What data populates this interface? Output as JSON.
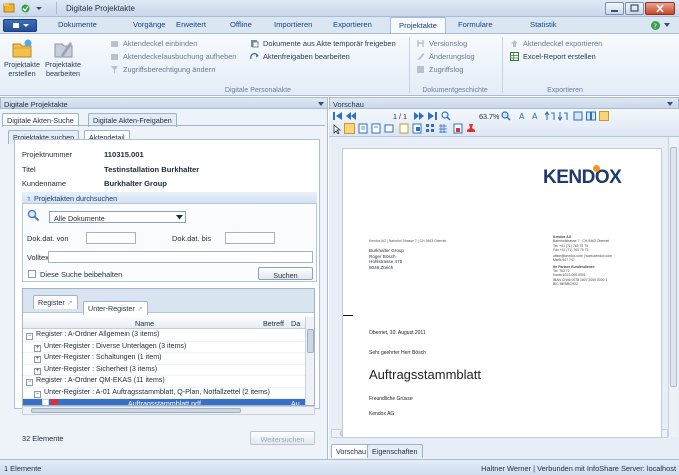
{
  "window": {
    "title": "Digitale Projektakte"
  },
  "ribbon": {
    "tabs": [
      "Dokumente",
      "Vorgänge",
      "Erweitert",
      "Offline",
      "Importieren",
      "Exportieren",
      "Projektakte",
      "Formulare",
      "Statistik"
    ],
    "active_tab": "Projektakte",
    "big_buttons": [
      {
        "label1": "Projektakte",
        "label2": "erstellen"
      },
      {
        "label1": "Projektakte",
        "label2": "bearbeiten"
      }
    ],
    "group1": {
      "items": [
        "Aktendeckel einbinden",
        "Aktendeckelausbuchung aufheben",
        "Zugriffsberechtigung ändern"
      ],
      "items_right": [
        "Dokumente aus Akte temporär freigeben",
        "Aktenfreigaben bearbeiten"
      ],
      "label": "Digitale Personalakte"
    },
    "group2": {
      "items": [
        "Versionslog",
        "Änderungslog",
        "Zugriffslog"
      ],
      "label": "Dokumentgeschichte"
    },
    "group3": {
      "items": [
        "Aktendeckel exportieren",
        "Excel-Report erstellen"
      ],
      "label": "Exportieren"
    }
  },
  "left_pane": {
    "title": "Digitale Projektakte",
    "tabs": [
      "Digitale Akten-Suche",
      "Digitale Akten-Freigaben"
    ],
    "subtabs": [
      "Projektakte suchen",
      "Aktendetail"
    ],
    "fields": {
      "projektnummer_label": "Projektnummer",
      "projektnummer": "110315.001",
      "titel_label": "Titel",
      "titel": "Testinstallation Burkhalter",
      "kundenname_label": "Kundenname",
      "kundenname": "Burkhalter Group"
    },
    "search": {
      "header": "Projektakten durchsuchen",
      "combo_value": "Alle Dokumente",
      "date_from_label": "Dok.dat. von",
      "date_to_label": "Dok.dat. bis",
      "fulltext_label": "Volltext:",
      "keep_search_label": "Diese Suche beibehalten",
      "search_button": "Suchen"
    },
    "grid": {
      "tabs": [
        "Register",
        "Unter-Register"
      ],
      "columns": [
        "Name",
        "Betreff",
        "Da"
      ],
      "rows": [
        {
          "level": 0,
          "text": "Register : A-Ordner Allgemein (3 items)",
          "state": "minus"
        },
        {
          "level": 1,
          "text": "Unter-Register : Diverse Unterlagen (3 items)",
          "state": "plus"
        },
        {
          "level": 1,
          "text": "Unter-Register : Schaltungen (1 item)",
          "state": "plus"
        },
        {
          "level": 1,
          "text": "Unter-Register : Sicherheit (3 items)",
          "state": "plus"
        },
        {
          "level": 0,
          "text": "Register : A-Ordner QM-EKAS (11 items)",
          "state": "minus"
        },
        {
          "level": 1,
          "text": "Unter-Register : A-01 Auftragsstammblatt, Q-Plan, Notfallzettel (2 items)",
          "state": "minus"
        },
        {
          "level": 2,
          "text": "Auftragsstammblatt.pdf",
          "state": "file",
          "extra": "Au"
        }
      ]
    },
    "count": "32 Elemente",
    "continue_button": "Weitersuchen"
  },
  "right_pane": {
    "title": "Vorschau",
    "page_indicator": "1 / 1",
    "zoom": "63.7%",
    "bottom_tabs": [
      "Vorschau",
      "Eigenschaften"
    ]
  },
  "document": {
    "logo": "KENDOX",
    "sender_line": "Kendox AG | Bahnhof Strasse 7 | CH-9463 Oberriet",
    "recipient": [
      "Burkhalter Group",
      "Roger Bösch",
      "Hohlstrasse 475",
      "8048 Zürich"
    ],
    "company_block": [
      "Kendox AG",
      "Bahnhofstrasse 7 · CH-9463 Oberriet",
      "Tel. +41 (71) 763 75 75",
      "Fax +41 (71) 763 75 73",
      "office@kendox.com | www.kendox.com",
      "MwSt 607 747",
      "Ihr Partner Kundendienst:",
      "Tel. 763 72",
      "Konto 6072-000.0001",
      "IBAN CH46 0078 1607 2000 0000 1",
      "BIC MEBBCH22"
    ],
    "date": "Oberriet, 10. August 2011",
    "salutation": "Sehr geehrter Herr Bösch",
    "heading": "Auftragsstammblatt",
    "closing": "Freundliche Grüsse",
    "sign": "Kendox AG"
  },
  "status": {
    "left": "1 Elemente",
    "right": "Haltner Werner | Verbunden mit InfoShare Server: localhost"
  }
}
